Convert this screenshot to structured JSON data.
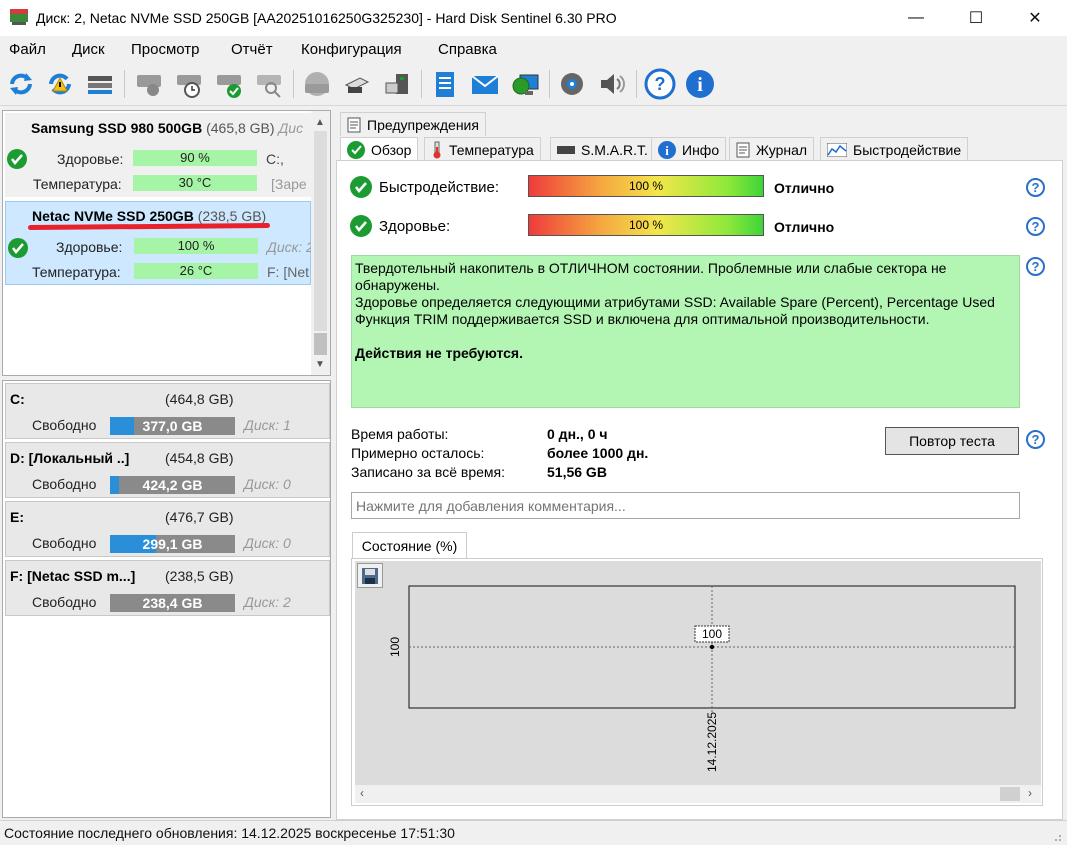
{
  "window": {
    "title": "Диск: 2, Netac NVMe SSD 250GB [AA20251016250G325230]  -  Hard Disk Sentinel 6.30 PRO",
    "minimize": "—",
    "maximize": "☐",
    "close": "✕"
  },
  "menu": [
    "Файл",
    "Диск",
    "Просмотр",
    "Отчёт",
    "Конфигурация",
    "Справка"
  ],
  "toolbar_icons": [
    "refresh-icon",
    "refresh-warning-icon",
    "disk-list-icon",
    "disk-check-icon",
    "disk-schedule-icon",
    "disk-ok-icon",
    "disk-search-icon",
    "disk-sphere-icon",
    "usb-icon",
    "usb-disk-icon",
    "report-icon",
    "email-icon",
    "network-icon",
    "settings-icon",
    "sound-icon",
    "help-icon",
    "info-icon"
  ],
  "disks": [
    {
      "name": "Samsung SSD 980 500GB",
      "size": "(465,8 GB)",
      "extra": "Дис",
      "health_label": "Здоровье:",
      "health": "90 %",
      "health_side": "C:,",
      "temp_label": "Температура:",
      "temp": "30 °C",
      "temp_side": "[Заре"
    },
    {
      "name": "Netac NVMe SSD 250GB",
      "size": "(238,5 GB)",
      "health_label": "Здоровье:",
      "health": "100 %",
      "health_side": "Диск: 2",
      "temp_label": "Температура:",
      "temp": "26 °C",
      "temp_side": "F: [Net"
    }
  ],
  "partitions": [
    {
      "name": "C:",
      "size": "(464,8 GB)",
      "free_label": "Свободно",
      "free": "377,0 GB",
      "fill": 0.19,
      "disk": "Диск: 1"
    },
    {
      "name": "D: [Локальный ..]",
      "size": "(454,8 GB)",
      "free_label": "Свободно",
      "free": "424,2 GB",
      "fill": 0.07,
      "disk": "Диск: 0"
    },
    {
      "name": "E:",
      "size": "(476,7 GB)",
      "free_label": "Свободно",
      "free": "299,1 GB",
      "fill": 0.37,
      "disk": "Диск: 0"
    },
    {
      "name": "F: [Netac SSD m...]",
      "size": "(238,5 GB)",
      "free_label": "Свободно",
      "free": "238,4 GB",
      "fill": 0.0,
      "disk": "Диск: 2"
    }
  ],
  "tabs_top": [
    "Предупреждения"
  ],
  "tabs": [
    "Обзор",
    "Температура",
    "S.M.A.R.T.",
    "Инфо",
    "Журнал",
    "Быстродействие"
  ],
  "overview": {
    "perf_label": "Быстродействие:",
    "perf_value": "100 %",
    "perf_status": "Отлично",
    "health_label": "Здоровье:",
    "health_value": "100 %",
    "health_status": "Отлично",
    "info_line1": "Твердотельный накопитель в ОТЛИЧНОМ состоянии. Проблемные или слабые сектора не обнаружены.",
    "info_line2": "Здоровье определяется следующими атрибутами SSD: Available Spare (Percent), Percentage Used",
    "info_line3": "Функция TRIM поддерживается SSD и включена для оптимальной производительности.",
    "info_action": "Действия не требуются.",
    "uptime_label": "Время работы:",
    "uptime": "0 дн., 0 ч",
    "remaining_label": "Примерно осталось:",
    "remaining": "более 1000 дн.",
    "written_label": "Записано за всё время:",
    "written": "51,56 GB",
    "retest_button": "Повтор теста",
    "comment_placeholder": "Нажмите для добавления комментария...",
    "chart_tab": "Состояние (%)"
  },
  "chart_data": {
    "type": "line",
    "title": "",
    "x": [
      "14.12.2025"
    ],
    "series": [
      {
        "values": [
          100
        ]
      }
    ],
    "data_labels": [
      "100"
    ],
    "ytick_labels": [
      "100"
    ],
    "xtick_labels": [
      "14.12.2025"
    ]
  },
  "status": "Состояние последнего обновления: 14.12.2025 воскресенье 17:51:30"
}
